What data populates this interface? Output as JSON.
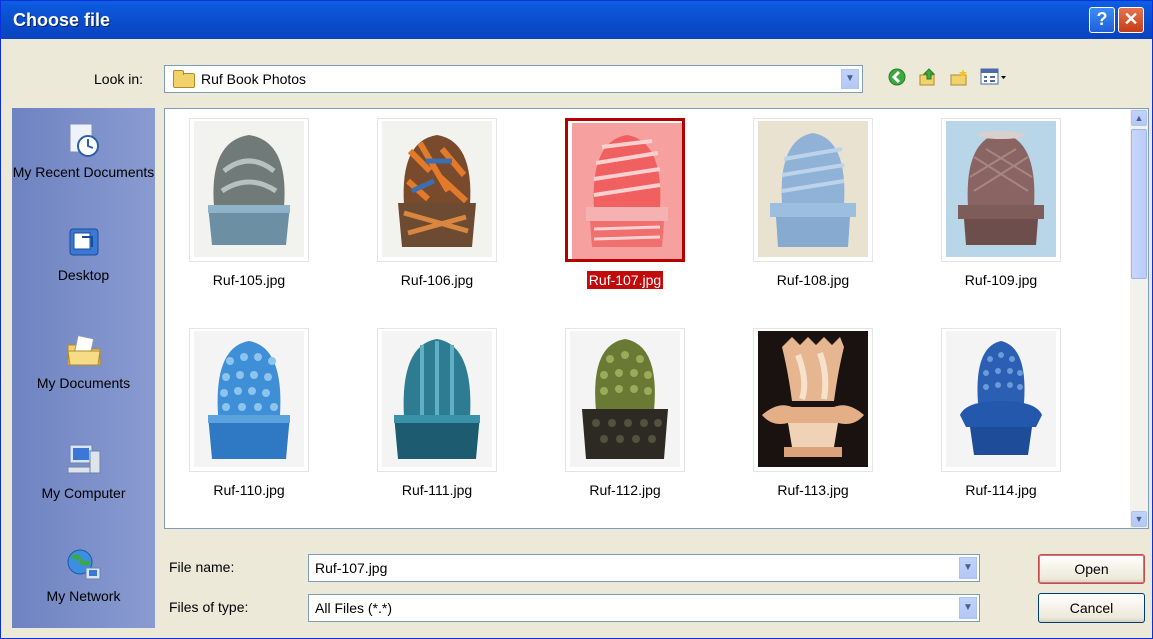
{
  "window": {
    "title": "Choose file",
    "help_label": "?",
    "close_label": "✕"
  },
  "toolbar": {
    "look_in_label": "Look in:",
    "look_in_value": "Ruf Book Photos"
  },
  "places": [
    {
      "label": "My Recent Documents",
      "icon": "recent-documents-icon"
    },
    {
      "label": "Desktop",
      "icon": "desktop-icon"
    },
    {
      "label": "My Documents",
      "icon": "my-documents-icon"
    },
    {
      "label": "My Computer",
      "icon": "my-computer-icon"
    },
    {
      "label": "My Network",
      "icon": "my-network-icon"
    }
  ],
  "files": [
    {
      "name": "Ruf-105.jpg",
      "selected": false
    },
    {
      "name": "Ruf-106.jpg",
      "selected": false
    },
    {
      "name": "Ruf-107.jpg",
      "selected": true
    },
    {
      "name": "Ruf-108.jpg",
      "selected": false
    },
    {
      "name": "Ruf-109.jpg",
      "selected": false
    },
    {
      "name": "Ruf-110.jpg",
      "selected": false
    },
    {
      "name": "Ruf-111.jpg",
      "selected": false
    },
    {
      "name": "Ruf-112.jpg",
      "selected": false
    },
    {
      "name": "Ruf-113.jpg",
      "selected": false
    },
    {
      "name": "Ruf-114.jpg",
      "selected": false
    }
  ],
  "footer": {
    "file_name_label": "File name:",
    "file_name_value": "Ruf-107.jpg",
    "file_type_label": "Files of type:",
    "file_type_value": "All Files (*.*)",
    "open_label": "Open",
    "cancel_label": "Cancel"
  },
  "colors": {
    "titlebar": "#0a4bc9",
    "selection": "#c10a0a",
    "places_bar": "#7f92c8"
  }
}
